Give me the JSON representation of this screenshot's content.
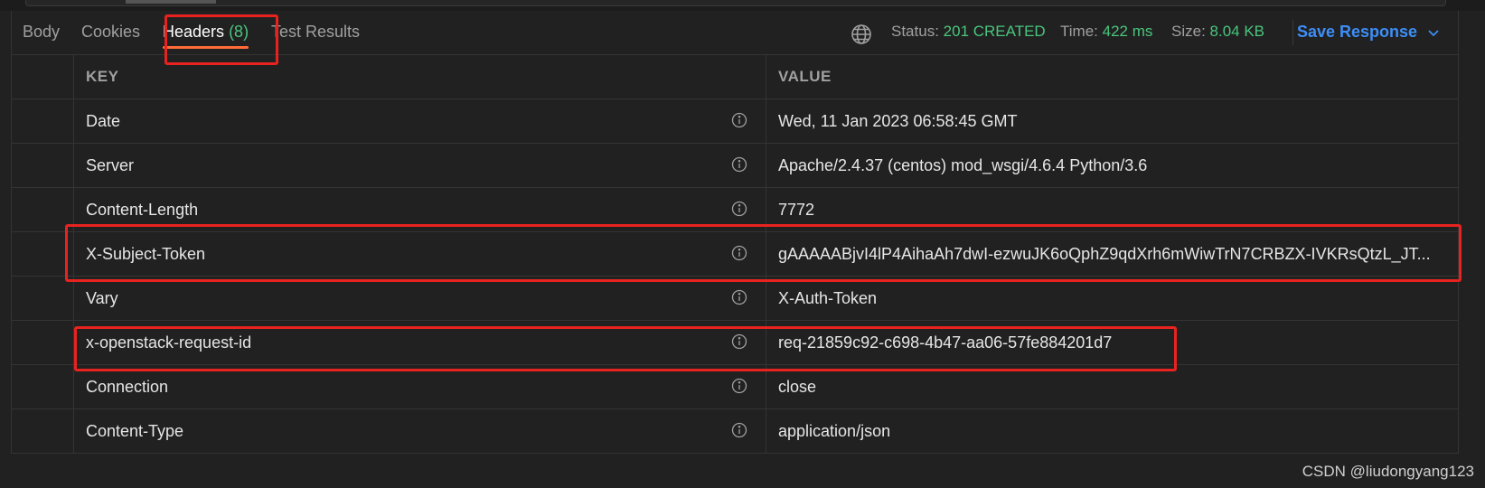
{
  "tabs": {
    "body": "Body",
    "cookies": "Cookies",
    "headers": "Headers",
    "headers_count": "(8)",
    "test_results": "Test Results"
  },
  "status": {
    "status_label": "Status:",
    "status_value": "201 CREATED",
    "time_label": "Time:",
    "time_value": "422 ms",
    "size_label": "Size:",
    "size_value": "8.04 KB",
    "save_label": "Save Response"
  },
  "table": {
    "key_header": "KEY",
    "value_header": "VALUE",
    "rows": [
      {
        "key": "Date",
        "value": "Wed, 11 Jan 2023 06:58:45 GMT"
      },
      {
        "key": "Server",
        "value": "Apache/2.4.37 (centos) mod_wsgi/4.6.4 Python/3.6"
      },
      {
        "key": "Content-Length",
        "value": "7772"
      },
      {
        "key": "X-Subject-Token",
        "value": "gAAAAABjvI4lP4AihaAh7dwI-ezwuJK6oQphZ9qdXrh6mWiwTrN7CRBZX-IVKRsQtzL_JT..."
      },
      {
        "key": "Vary",
        "value": "X-Auth-Token"
      },
      {
        "key": "x-openstack-request-id",
        "value": "req-21859c92-c698-4b47-aa06-57fe884201d7"
      },
      {
        "key": "Connection",
        "value": "close"
      },
      {
        "key": "Content-Type",
        "value": "application/json"
      }
    ]
  },
  "watermark": "CSDN @liudongyang123",
  "colors": {
    "background": "#212121",
    "success": "#49c67d",
    "accent": "#3d8ef7",
    "tab_underline": "#ff6c37",
    "highlight": "#e8231f"
  },
  "icons": {
    "globe": "globe-icon",
    "info": "info-icon",
    "chevron": "chevron-down-icon"
  }
}
